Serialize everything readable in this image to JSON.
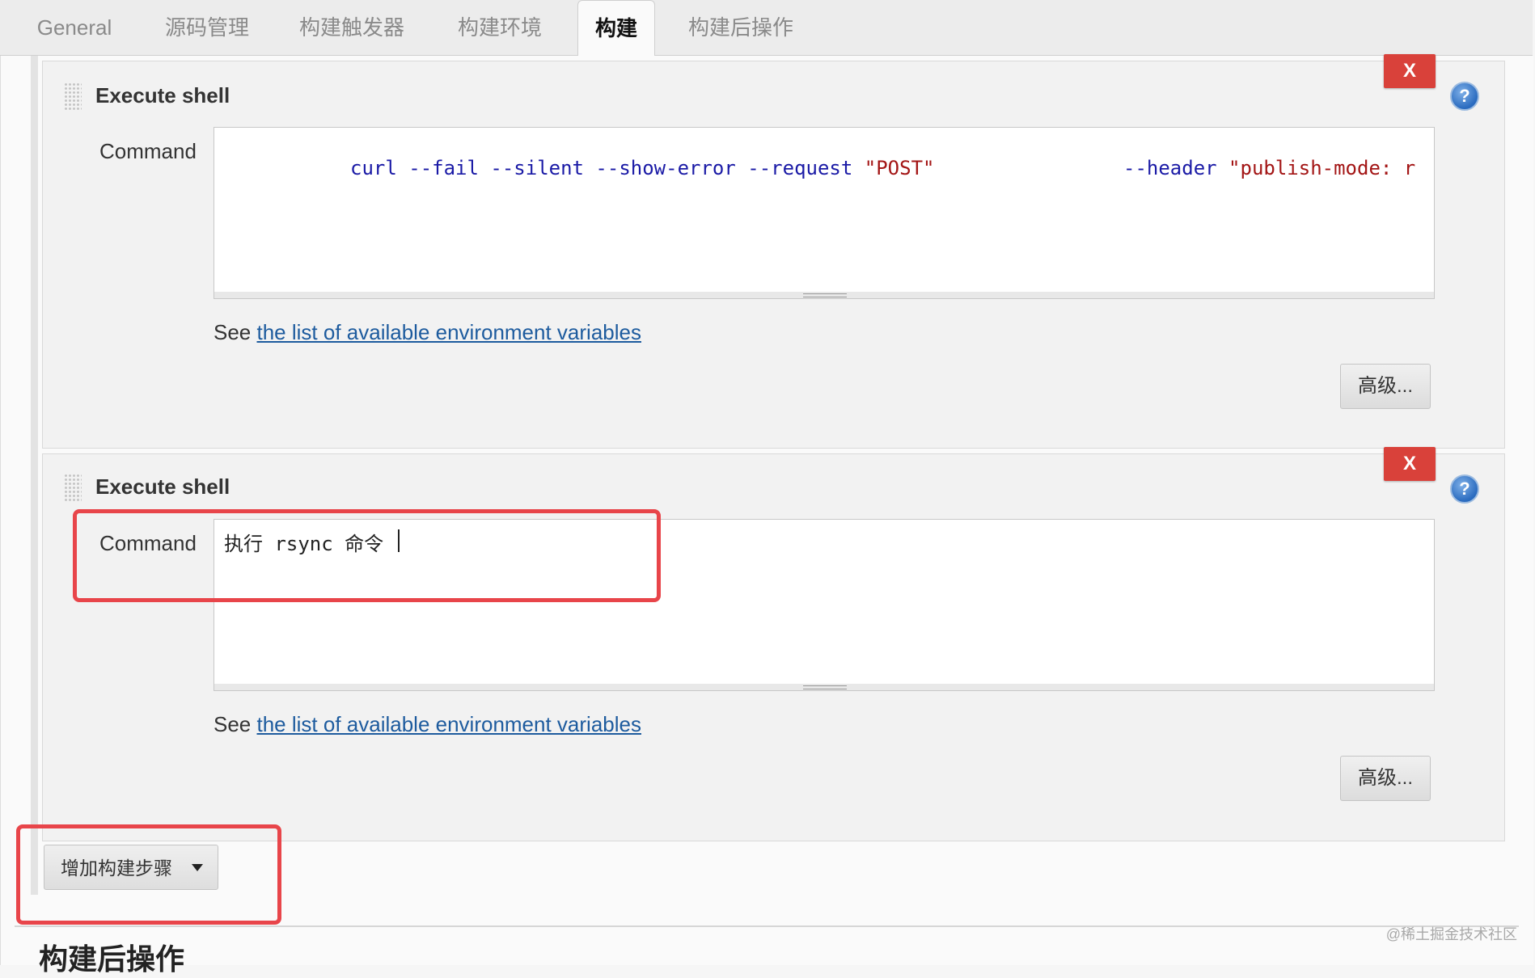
{
  "tabs": [
    {
      "label": "General"
    },
    {
      "label": "源码管理"
    },
    {
      "label": "构建触发器"
    },
    {
      "label": "构建环境"
    },
    {
      "label": "构建",
      "active": true
    },
    {
      "label": "构建后操作"
    }
  ],
  "steps": [
    {
      "title": "Execute shell",
      "delete_label": "X",
      "help_label": "?",
      "command_label": "Command",
      "command_parts": {
        "p1": "curl --fail --silent --show-error --request ",
        "p2": "\"POST\"",
        "p3": "--header ",
        "p4": "\"publish-mode: r"
      },
      "see_prefix": "See ",
      "see_link": "the list of available environment variables",
      "advanced_label": "高级..."
    },
    {
      "title": "Execute shell",
      "delete_label": "X",
      "help_label": "?",
      "command_label": "Command",
      "command_value": "执行 rsync 命令",
      "see_prefix": "See ",
      "see_link": "the list of available environment variables",
      "advanced_label": "高级..."
    }
  ],
  "add_step_label": "增加构建步骤",
  "section_heading": "构建后操作",
  "watermark": "@稀土掘金技术社区",
  "colors": {
    "annotation": "#e8454a",
    "delete": "#d9413a",
    "link": "#1d5b9e"
  }
}
